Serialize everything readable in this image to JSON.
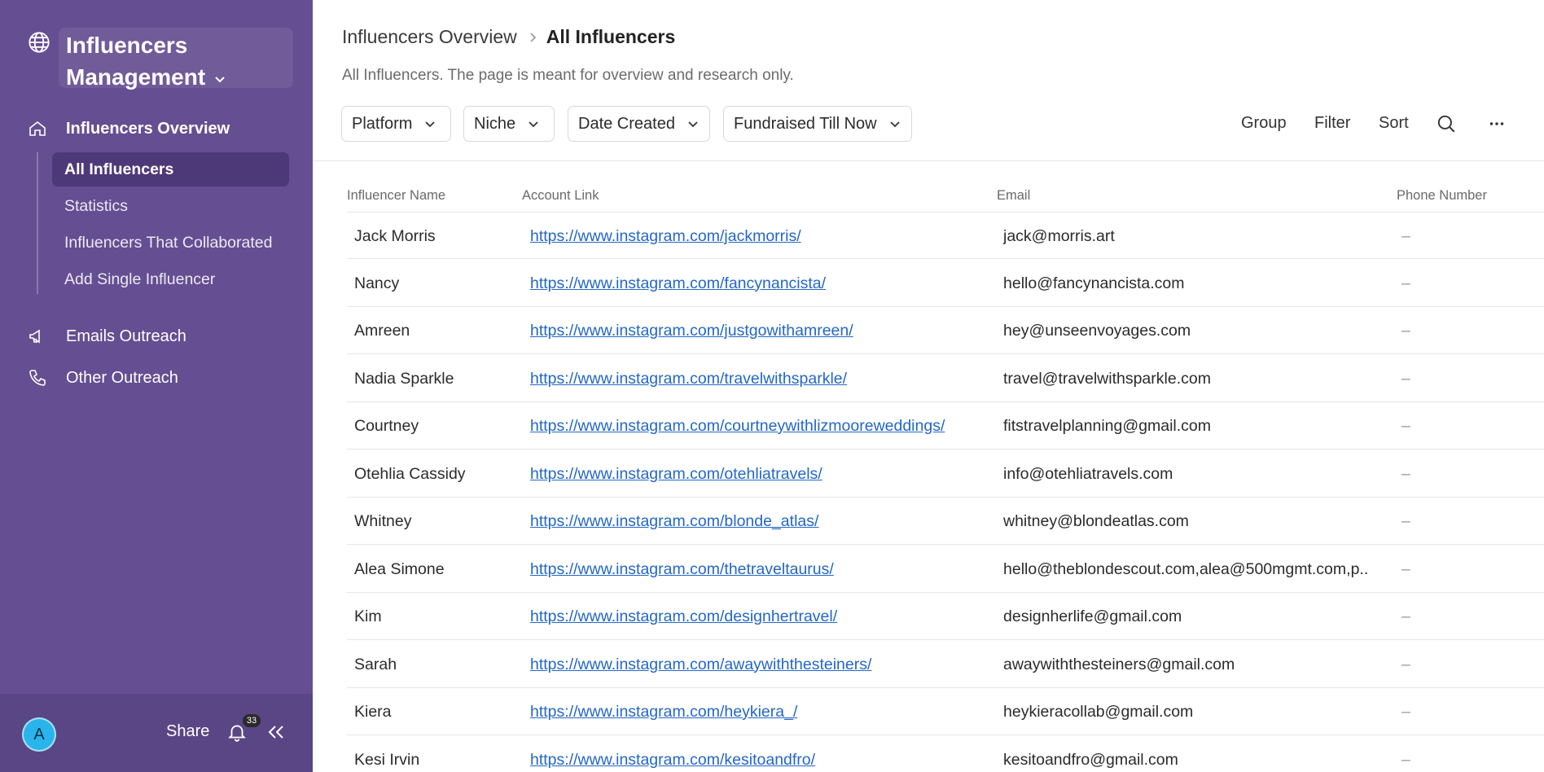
{
  "workspace": {
    "title": "Influencers Management"
  },
  "nav": {
    "overview": "Influencers Overview",
    "sub_items": [
      "All Influencers",
      "Statistics",
      "Influencers That Collaborated",
      "Add Single Influencer"
    ],
    "emails_outreach": "Emails Outreach",
    "other_outreach": "Other Outreach"
  },
  "footer": {
    "avatar_letter": "A",
    "share_label": "Share",
    "notification_count": "33"
  },
  "header": {
    "breadcrumb_parent": "Influencers Overview",
    "breadcrumb_current": "All Influencers",
    "subtitle": "All Influencers. The page is meant for overview and research only."
  },
  "filters": [
    "Platform",
    "Niche",
    "Date Created",
    "Fundraised Till Now"
  ],
  "toolbar": {
    "group": "Group",
    "filter": "Filter",
    "sort": "Sort"
  },
  "table": {
    "columns": [
      "Influencer Name",
      "Account Link",
      "Email",
      "Phone Number"
    ],
    "rows": [
      {
        "name": "Jack Morris",
        "link": "https://www.instagram.com/jackmorris/",
        "email": "jack@morris.art",
        "phone": "–"
      },
      {
        "name": "Nancy",
        "link": "https://www.instagram.com/fancynancista/",
        "email": "hello@fancynancista.com",
        "phone": "–"
      },
      {
        "name": "Amreen",
        "link": "https://www.instagram.com/justgowithamreen/",
        "email": "hey@unseenvoyages.com",
        "phone": "–"
      },
      {
        "name": "Nadia Sparkle",
        "link": "https://www.instagram.com/travelwithsparkle/",
        "email": "travel@travelwithsparkle.com",
        "phone": "–"
      },
      {
        "name": "Courtney",
        "link": "https://www.instagram.com/courtneywithlizmooreweddings/",
        "email": "fitstravelplanning@gmail.com",
        "phone": "–"
      },
      {
        "name": "Otehlia Cassidy",
        "link": "https://www.instagram.com/otehliatravels/",
        "email": "info@otehliatravels.com",
        "phone": "–"
      },
      {
        "name": "Whitney",
        "link": "https://www.instagram.com/blonde_atlas/",
        "email": "whitney@blondeatlas.com",
        "phone": "–"
      },
      {
        "name": "Alea Simone",
        "link": "https://www.instagram.com/thetraveltaurus/",
        "email": "hello@theblondescout.com,alea@500mgmt.com,p...",
        "phone": "–"
      },
      {
        "name": "Kim",
        "link": "https://www.instagram.com/designhertravel/",
        "email": "designherlife@gmail.com",
        "phone": "–"
      },
      {
        "name": "Sarah",
        "link": "https://www.instagram.com/awaywiththesteiners/",
        "email": "awaywiththesteiners@gmail.com",
        "phone": "–"
      },
      {
        "name": "Kiera",
        "link": "https://www.instagram.com/heykiera_/",
        "email": "heykieracollab@gmail.com",
        "phone": "–"
      },
      {
        "name": "Kesi Irvin",
        "link": "https://www.instagram.com/kesitoandfro/",
        "email": "kesitoandfro@gmail.com",
        "phone": "–"
      }
    ]
  },
  "icons": {
    "workspace": "globe-icon",
    "overview": "home-icon",
    "emails": "megaphone-icon",
    "other": "phone-icon",
    "search": "search-icon",
    "more": "more-icon",
    "bell": "bell-icon",
    "collapse": "collapse-sidebar-icon"
  },
  "colors": {
    "sidebar": "#654e91",
    "link": "#2367c7",
    "avatar": "#2ab4ec"
  }
}
